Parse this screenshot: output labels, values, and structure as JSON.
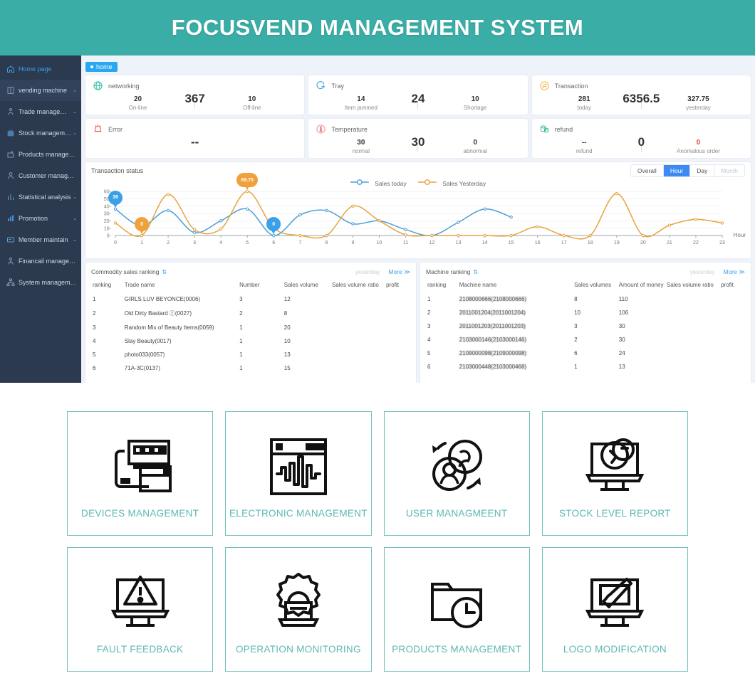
{
  "header": {
    "title": "FOCUSVEND MANAGEMENT SYSTEM",
    "brand_color": "#3aada6"
  },
  "sidebar": {
    "items": [
      {
        "label": "Home page",
        "icon": "home-icon",
        "caret": "",
        "active": true
      },
      {
        "label": "vending machine",
        "icon": "machine-icon",
        "caret": "⌄"
      },
      {
        "label": "Trade management",
        "icon": "trade-icon",
        "caret": "⌄"
      },
      {
        "label": "Stock management",
        "icon": "stock-icon",
        "caret": "⌄"
      },
      {
        "label": "Products management",
        "icon": "products-icon",
        "caret": ""
      },
      {
        "label": "Customer management",
        "icon": "customer-icon",
        "caret": ""
      },
      {
        "label": "Statistical analysis",
        "icon": "stats-icon",
        "caret": "⌄"
      },
      {
        "label": "Promotion",
        "icon": "promotion-icon",
        "caret": "⌄"
      },
      {
        "label": "Member maintain",
        "icon": "member-icon",
        "caret": "⌄"
      },
      {
        "label": "Financail management",
        "icon": "finance-icon",
        "caret": ""
      },
      {
        "label": "System management",
        "icon": "system-icon",
        "caret": ""
      }
    ]
  },
  "tab": {
    "label": "home"
  },
  "kpis": [
    {
      "title": "networking",
      "icon": "globe-icon",
      "main": "367",
      "left": {
        "value": "20",
        "label": "On-line"
      },
      "right": {
        "value": "10",
        "label": "Off-line"
      }
    },
    {
      "title": "Tray",
      "icon": "tray-cycle-icon",
      "main": "24",
      "left": {
        "value": "14",
        "label": "Item jammed"
      },
      "right": {
        "value": "10",
        "label": "Shortage"
      }
    },
    {
      "title": "Transaction",
      "icon": "exchange-icon",
      "main": "6356.5",
      "left": {
        "value": "281",
        "label": "today"
      },
      "right": {
        "value": "327.75",
        "label": "yesterday"
      }
    },
    {
      "title": "Error",
      "icon": "alarm-icon",
      "main": "--",
      "left": {
        "value": "",
        "label": ""
      },
      "right": {
        "value": "",
        "label": ""
      }
    },
    {
      "title": "Temperature",
      "icon": "thermometer-icon",
      "main": "30",
      "left": {
        "value": "30",
        "label": "normal"
      },
      "right": {
        "value": "0",
        "label": "abnormal"
      }
    },
    {
      "title": "refund",
      "icon": "coins-icon",
      "main": "0",
      "left": {
        "value": "--",
        "label": "refund"
      },
      "right": {
        "value": "0",
        "label": "Anomalous order",
        "red": true
      }
    }
  ],
  "chart": {
    "title": "Transaction status",
    "range_buttons": [
      {
        "label": "Overall",
        "state": "normal"
      },
      {
        "label": "Hour",
        "state": "active"
      },
      {
        "label": "Day",
        "state": "normal"
      },
      {
        "label": "Month",
        "state": "disabled"
      }
    ],
    "pins": [
      {
        "value": "36",
        "series": "today"
      },
      {
        "value": "0",
        "series": "yesterday"
      },
      {
        "value": "69.75",
        "series": "yesterday"
      },
      {
        "value": "0",
        "series": "today"
      }
    ]
  },
  "chart_data": {
    "type": "line",
    "title": "Transaction status",
    "xlabel": "Hour",
    "ylabel": "",
    "xlim": [
      0,
      23
    ],
    "ylim": [
      0,
      60
    ],
    "yticks": [
      "0",
      "10",
      "20",
      "30",
      "40",
      "50",
      "60"
    ],
    "xticks": [
      "0",
      "1",
      "2",
      "3",
      "4",
      "5",
      "6",
      "7",
      "8",
      "9",
      "10",
      "11",
      "12",
      "13",
      "14",
      "15",
      "16",
      "17",
      "18",
      "19",
      "20",
      "21",
      "22",
      "23"
    ],
    "grid": true,
    "legend_position": "top-center",
    "series": [
      {
        "name": "Sales today",
        "color": "#4a9fd8",
        "x": [
          0,
          1,
          2,
          3,
          4,
          5,
          6,
          7,
          8,
          9,
          10,
          11,
          12,
          13,
          14,
          15
        ],
        "values": [
          36,
          13,
          34,
          4,
          20,
          36,
          0,
          28,
          34,
          16,
          20,
          8,
          0,
          18,
          36,
          25
        ]
      },
      {
        "name": "Sales Yesterday",
        "color": "#e8a33d",
        "x": [
          0,
          1,
          2,
          3,
          4,
          5,
          6,
          7,
          8,
          9,
          10,
          11,
          12,
          13,
          14,
          15,
          16,
          17,
          18,
          19,
          20,
          21,
          22,
          23
        ],
        "values": [
          17,
          0,
          56,
          8,
          9,
          69.75,
          10,
          0,
          0,
          40,
          20,
          1,
          0,
          0,
          0,
          0,
          12,
          0,
          0,
          57,
          0,
          14,
          22,
          17
        ]
      }
    ],
    "annotations": [
      {
        "x": 0,
        "y": 36,
        "text": "36",
        "series": "Sales today"
      },
      {
        "x": 1,
        "y": 0,
        "text": "0",
        "series": "Sales Yesterday"
      },
      {
        "x": 5,
        "y": 69.75,
        "text": "69.75",
        "series": "Sales Yesterday"
      },
      {
        "x": 6,
        "y": 0,
        "text": "0",
        "series": "Sales today"
      }
    ]
  },
  "commodity_table": {
    "title": "Commodity sales ranking",
    "yesterday_label": "yesterday",
    "more_label": "More ≫",
    "columns": [
      "ranking",
      "Trade name",
      "Number",
      "Sales volume",
      "Sales volume ratio",
      "profit"
    ],
    "rows": [
      [
        "1",
        "GIRLS LUV BEYONCE(0006)",
        "3",
        "12",
        "",
        ""
      ],
      [
        "2",
        "Old Dirty Bastard ⓣ(0027)",
        "2",
        "8",
        "",
        ""
      ],
      [
        "3",
        "Random Mix of Beauty Items(0059)",
        "1",
        "20",
        "",
        ""
      ],
      [
        "4",
        "Slay Beauty(0017)",
        "1",
        "10",
        "",
        ""
      ],
      [
        "5",
        "photo033(0057)",
        "1",
        "13",
        "",
        ""
      ],
      [
        "6",
        "71A-3C(0137)",
        "1",
        "15",
        "",
        ""
      ]
    ]
  },
  "machine_table": {
    "title": "Machine ranking",
    "yesterday_label": "yesterday",
    "more_label": "More ≫",
    "columns": [
      "ranking",
      "Machine name",
      "Sales volumes",
      "Amount of money",
      "Sales volume ratio",
      "profit"
    ],
    "rows": [
      [
        "1",
        "2108000666(2108000666)",
        "8",
        "110",
        "",
        ""
      ],
      [
        "2",
        "2011001204(2011001204)",
        "10",
        "106",
        "",
        ""
      ],
      [
        "3",
        "2011001203(2011001203)",
        "3",
        "30",
        "",
        ""
      ],
      [
        "4",
        "2103000146(2103000146)",
        "2",
        "30",
        "",
        ""
      ],
      [
        "5",
        "2109000098(2109000098)",
        "6",
        "24",
        "",
        ""
      ],
      [
        "6",
        "2103000448(2103000468)",
        "1",
        "13",
        "",
        ""
      ]
    ]
  },
  "features": [
    {
      "label": "DEVICES MANAGEMENT",
      "icon": "devices-icon"
    },
    {
      "label": "ELECTRONIC MANAGEMENT",
      "icon": "waveform-window-icon"
    },
    {
      "label": "USER MANAGMEENT",
      "icon": "users-cycle-icon"
    },
    {
      "label": "STOCK LEVEL REPORT",
      "icon": "monitor-chart-icon"
    },
    {
      "label": "FAULT FEEDBACK",
      "icon": "monitor-warning-icon"
    },
    {
      "label": "OPERATION MONITORING",
      "icon": "gear-laptop-icon"
    },
    {
      "label": "PRODUCTS MANAGEMENT",
      "icon": "folder-clock-icon"
    },
    {
      "label": "LOGO MODIFICATION",
      "icon": "monitor-brush-icon"
    }
  ],
  "colors": {
    "accent_teal": "#5bb8b2",
    "accent_blue": "#3ba0e8",
    "series_today": "#4a9fd8",
    "series_yesterday": "#e8a33d"
  }
}
